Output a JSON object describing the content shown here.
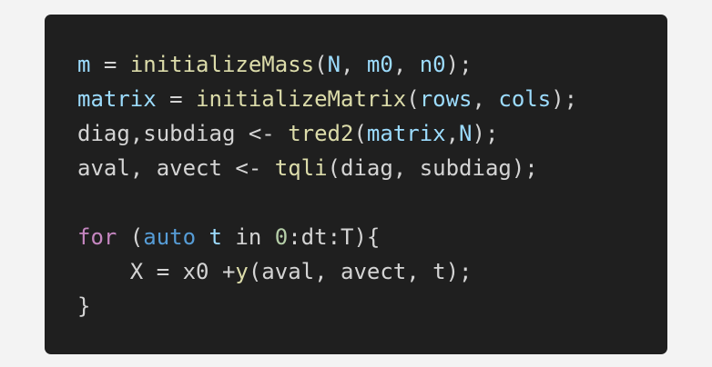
{
  "theme": {
    "page_bg": "#f3f3f3",
    "panel_bg": "#1f1f1f",
    "default_text": "#d4d4d4",
    "variable": "#9cdcfe",
    "function": "#dcdcaa",
    "keyword": "#c586c0",
    "type": "#569cd6",
    "number": "#b5cea8"
  },
  "code": {
    "lines": [
      {
        "tokens": [
          {
            "t": "m",
            "k": "var"
          },
          {
            "t": " = ",
            "k": "text"
          },
          {
            "t": "initializeMass",
            "k": "fn"
          },
          {
            "t": "(",
            "k": "text"
          },
          {
            "t": "N",
            "k": "var"
          },
          {
            "t": ", ",
            "k": "text"
          },
          {
            "t": "m0",
            "k": "var"
          },
          {
            "t": ", ",
            "k": "text"
          },
          {
            "t": "n0",
            "k": "var"
          },
          {
            "t": ");",
            "k": "text"
          }
        ]
      },
      {
        "tokens": [
          {
            "t": "matrix",
            "k": "var"
          },
          {
            "t": " = ",
            "k": "text"
          },
          {
            "t": "initializeMatrix",
            "k": "fn"
          },
          {
            "t": "(",
            "k": "text"
          },
          {
            "t": "rows",
            "k": "var"
          },
          {
            "t": ", ",
            "k": "text"
          },
          {
            "t": "cols",
            "k": "var"
          },
          {
            "t": ");",
            "k": "text"
          }
        ]
      },
      {
        "tokens": [
          {
            "t": "diag,subdiag <- ",
            "k": "text"
          },
          {
            "t": "tred2",
            "k": "fn"
          },
          {
            "t": "(",
            "k": "text"
          },
          {
            "t": "matrix",
            "k": "var"
          },
          {
            "t": ",",
            "k": "text"
          },
          {
            "t": "N",
            "k": "var"
          },
          {
            "t": ");",
            "k": "text"
          }
        ]
      },
      {
        "tokens": [
          {
            "t": "aval, avect <- ",
            "k": "text"
          },
          {
            "t": "tqli",
            "k": "fn"
          },
          {
            "t": "(diag, subdiag);",
            "k": "text"
          }
        ]
      },
      {
        "tokens": []
      },
      {
        "tokens": [
          {
            "t": "for",
            "k": "kw"
          },
          {
            "t": " (",
            "k": "text"
          },
          {
            "t": "auto",
            "k": "type"
          },
          {
            "t": " ",
            "k": "text"
          },
          {
            "t": "t",
            "k": "var"
          },
          {
            "t": " in ",
            "k": "text"
          },
          {
            "t": "0",
            "k": "num"
          },
          {
            "t": ":dt:T){",
            "k": "text"
          }
        ]
      },
      {
        "tokens": [
          {
            "t": "    X = x0 +",
            "k": "text"
          },
          {
            "t": "y",
            "k": "fn"
          },
          {
            "t": "(aval, avect, t);",
            "k": "text"
          }
        ]
      },
      {
        "tokens": [
          {
            "t": "}",
            "k": "text"
          }
        ]
      }
    ]
  }
}
